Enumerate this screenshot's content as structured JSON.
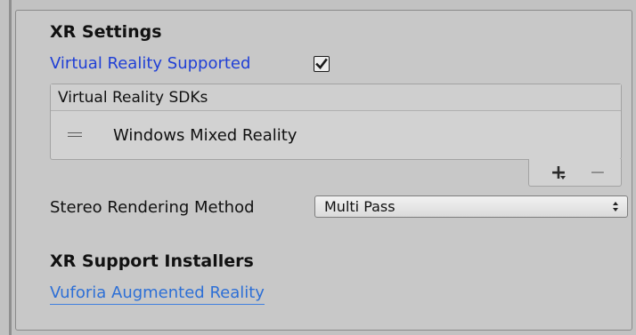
{
  "xr_settings": {
    "title": "XR Settings",
    "vr_supported_label": "Virtual Reality Supported",
    "vr_supported_checked": true,
    "sdk_list": {
      "header": "Virtual Reality SDKs",
      "items": [
        {
          "label": "Windows Mixed Reality"
        }
      ],
      "add_label": "+",
      "remove_label": "−"
    },
    "stereo_rendering": {
      "label": "Stereo Rendering Method",
      "value": "Multi Pass"
    }
  },
  "installers": {
    "title": "XR Support Installers",
    "links": [
      {
        "label": "Vuforia Augmented Reality"
      }
    ]
  },
  "colors": {
    "link": "#2d6fd6",
    "label_highlight": "#1f3fd6",
    "panel_bg": "#c8c8c8"
  },
  "icons": {
    "checkbox": "check-icon",
    "drag": "drag-handle-icon",
    "dropdown": "chevron-up-down-icon"
  }
}
